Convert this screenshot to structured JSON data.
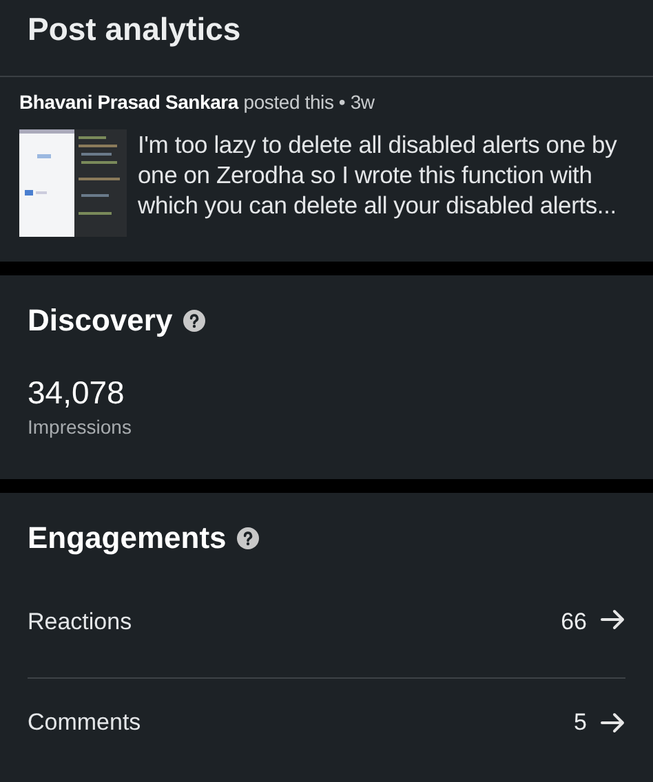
{
  "header": {
    "title": "Post analytics"
  },
  "post": {
    "author": "Bhavani Prasad Sankara",
    "meta": "posted this • 3w",
    "excerpt": "I'm too lazy to delete all disabled alerts one by one on Zerodha so I wrote this function with which you can delete all your disabled alerts..."
  },
  "discovery": {
    "title": "Discovery",
    "value": "34,078",
    "label": "Impressions"
  },
  "engagements": {
    "title": "Engagements",
    "rows": [
      {
        "label": "Reactions",
        "value": "66"
      },
      {
        "label": "Comments",
        "value": "5"
      }
    ]
  }
}
